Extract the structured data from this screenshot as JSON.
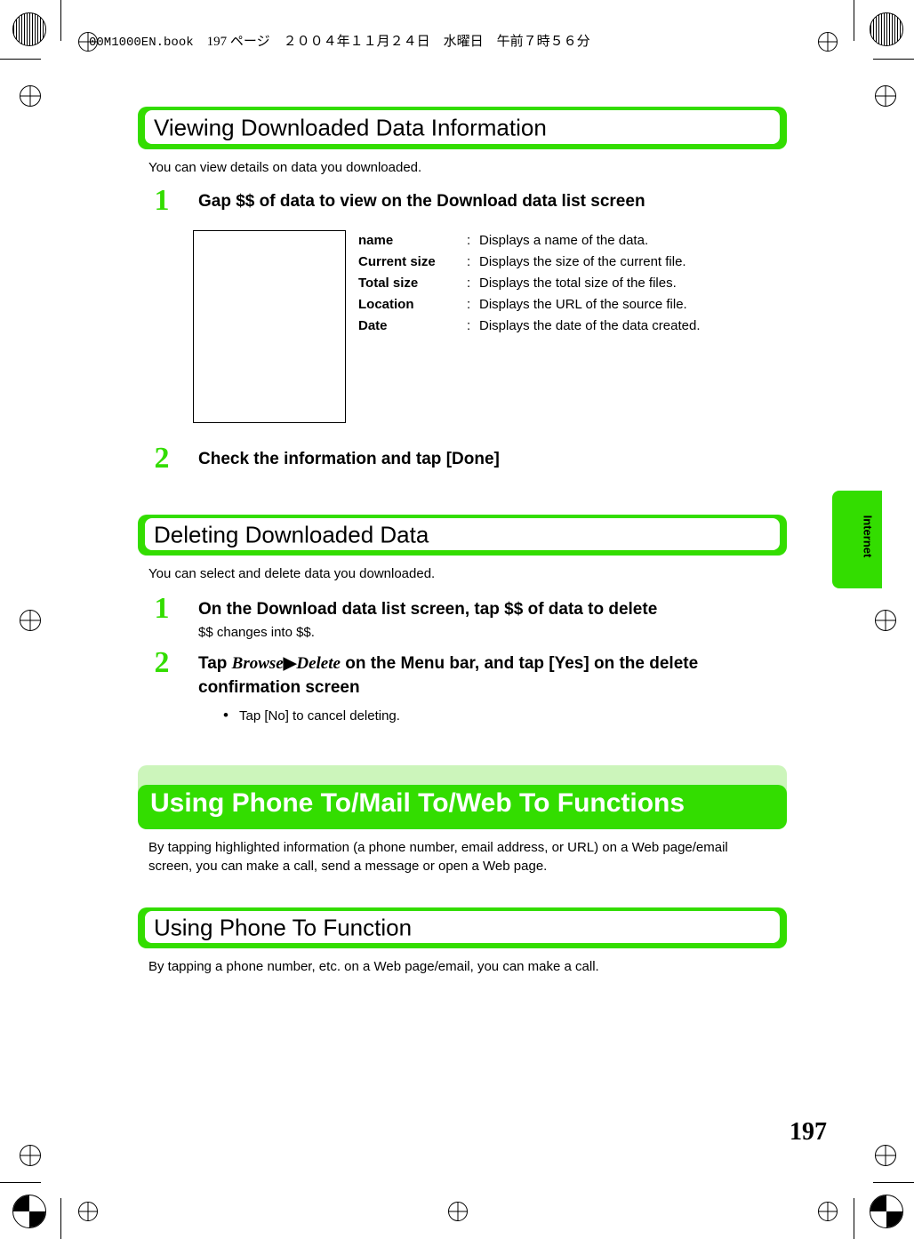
{
  "header": {
    "filename": "00M1000EN.book",
    "page_marker": "197 ページ",
    "date": "２００４年１１月２４日　水曜日　午前７時５６分"
  },
  "sections": [
    {
      "heading": "Viewing Downloaded Data Information",
      "intro": "You can view details on data you downloaded.",
      "steps": [
        {
          "num": "1",
          "title": "Gap $$ of data to view on the Download data list screen"
        },
        {
          "num": "2",
          "title": "Check the information and tap [Done]"
        }
      ],
      "definitions": [
        {
          "key": "name",
          "sep": ":",
          "value": "Displays a name of the data."
        },
        {
          "key": "Current size",
          "sep": ":",
          "value": "Displays the size of the current file."
        },
        {
          "key": "Total size",
          "sep": ":",
          "value": "Displays the total size of the files."
        },
        {
          "key": "Location",
          "sep": ":",
          "value": "Displays the URL of the source file."
        },
        {
          "key": "Date",
          "sep": ":",
          "value": "Displays the date of the data created."
        }
      ]
    },
    {
      "heading": "Deleting Downloaded Data",
      "intro": "You can select and delete data you downloaded.",
      "step1": {
        "num": "1",
        "title": "On the Download data list screen, tap $$ of data to delete",
        "sub": "$$ changes into $$."
      },
      "step2": {
        "num": "2",
        "title_pre": "Tap ",
        "title_italic1": "Browse",
        "title_arrow": "▶",
        "title_italic2": "Delete",
        "title_post": " on the Menu bar, and tap [Yes] on the delete confirmation screen",
        "bullet": "Tap [No] to cancel deleting."
      }
    },
    {
      "banner": "Using Phone To/Mail To/Web To Functions",
      "banner_text": "By tapping highlighted information (a phone number, email address, or URL) on a Web page/email screen, you can make a call, send a message or open a Web page."
    },
    {
      "heading": "Using Phone To Function",
      "intro": "By tapping a phone number, etc. on a Web page/email, you can make a call."
    }
  ],
  "side_tab": {
    "label": "Internet"
  },
  "page_number": "197",
  "colors": {
    "accent_green": "#33dd00",
    "pale_green": "#ccf5bb"
  }
}
